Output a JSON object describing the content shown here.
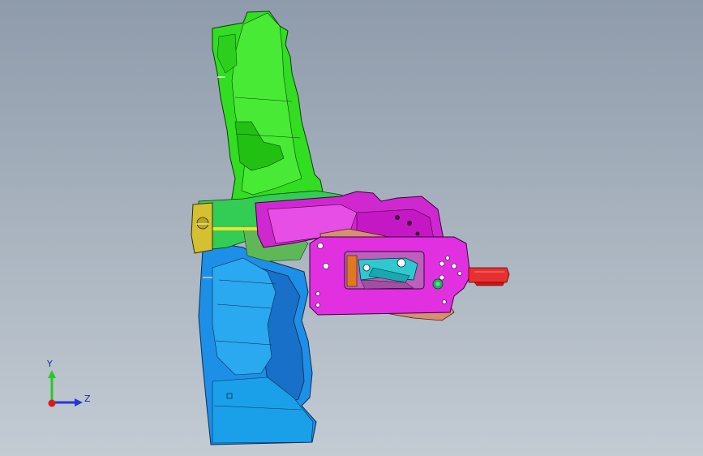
{
  "viewport": {
    "background_top": "#8e9bab",
    "background_bottom": "#c3cbd3"
  },
  "model": {
    "parts": [
      {
        "name": "upper-arm",
        "color": "#33dd22"
      },
      {
        "name": "lower-body",
        "color": "#1e8fe6"
      },
      {
        "name": "bracket",
        "color": "#e020e0"
      },
      {
        "name": "side-plate",
        "color": "#d4c030"
      },
      {
        "name": "inner-link",
        "color": "#30c8d0"
      },
      {
        "name": "pin",
        "color": "#e83030"
      }
    ]
  },
  "triad": {
    "y_label": "Y",
    "z_label": "Z",
    "y_color": "#28c828",
    "z_color": "#2438d8",
    "x_color": "#e01818"
  }
}
